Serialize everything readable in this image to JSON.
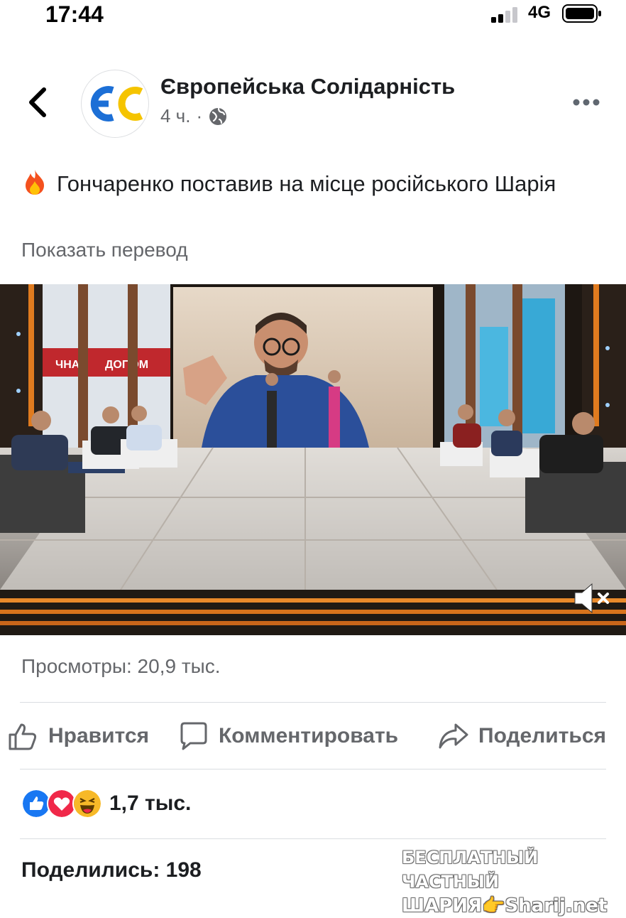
{
  "status_bar": {
    "time": "17:44",
    "network": "4G"
  },
  "header": {
    "page_name": "Європейська Солідарність",
    "logo_text": "ЄС",
    "time_ago": "4 ч.",
    "separator": "·",
    "privacy_icon": "globe-icon",
    "back_icon": "chevron-left-icon",
    "more_icon": "more-horizontal-icon"
  },
  "post": {
    "emoji_icon": "fire-emoji-icon",
    "text": "Гончаренко поставив на місце російського Шарія",
    "translate_link": "Показать перевод"
  },
  "video": {
    "mute_icon": "muted-speaker-icon",
    "caption_words": [
      "ЧНА",
      "ДОПОМ"
    ]
  },
  "stats": {
    "views": "Просмотры: 20,9 тыс."
  },
  "actions": {
    "like": "Нравится",
    "comment": "Комментировать",
    "share": "Поделиться"
  },
  "reactions": {
    "icons": [
      "like-reaction-icon",
      "love-reaction-icon",
      "haha-reaction-icon"
    ],
    "count": "1,7 тыс."
  },
  "shares": "Поделились: 198",
  "watermark": {
    "line1": "БЕСПЛАТНЫЙ ЧАСТНЫЙ",
    "line2": "ШАРИЯ👉Sharij.net"
  },
  "colors": {
    "logo_blue": "#1c6fd6",
    "logo_yellow": "#f5c400",
    "like_blue": "#1877f2",
    "love_red": "#f02849",
    "haha_yellow": "#f7b928",
    "secondary_text": "#65676b"
  }
}
